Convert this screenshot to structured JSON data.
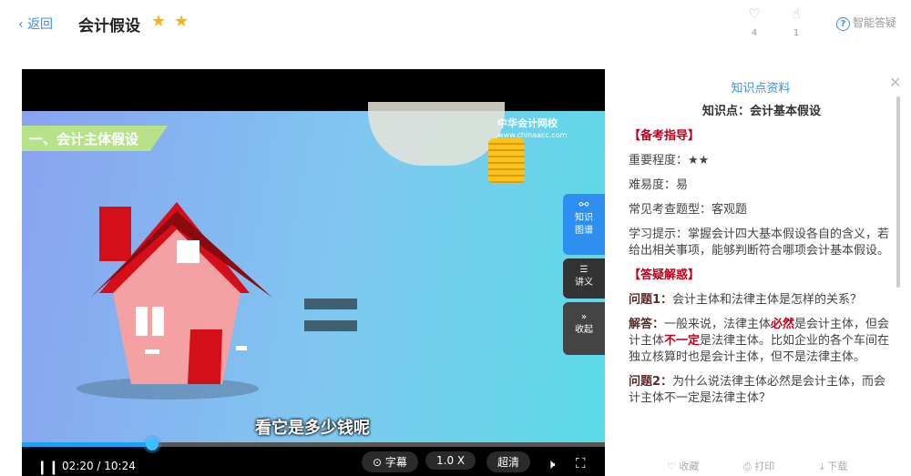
{
  "header": {
    "back": "返回",
    "title": "会计假设",
    "stars": 2,
    "like_count": "4",
    "thumb_count": "1",
    "ai_label": "智能答疑"
  },
  "video": {
    "ribbon": "一、会计主体假设",
    "logo_name": "中华会计网校",
    "logo_url": "www.chinaacc.com",
    "subtitle": "看它是多少钱呢",
    "side": [
      {
        "label1": "知识",
        "label2": "图谱",
        "color": "#2f8ff0"
      },
      {
        "label1": "讲义",
        "color": "#333"
      },
      {
        "label1": "收起",
        "color": "#444"
      }
    ],
    "progress": 0.224,
    "time": "02:20 / 10:24",
    "caption_btn": "字幕",
    "speed": "1.0 X",
    "quality": "超清"
  },
  "panel": {
    "title": "知识点资料",
    "kp": "知识点：会计基本假设",
    "sec1": "【备考指导】",
    "importance": "重要程度：★★",
    "difficulty": "难易度：易",
    "qtype": "常见考查题型：客观题",
    "tip": "学习提示：掌握会计四大基本假设各自的含义，若给出相关事项，能够判断符合哪项会计基本假设。",
    "sec2": "【答疑解惑】",
    "q1_label": "问题1：",
    "q1": "会计主体和法律主体是怎样的关系？",
    "a1_label": "解答：",
    "a1_p1": "一般来说，法律主体",
    "a1_r1": "必然",
    "a1_p2": "是会计主体，但会计主体",
    "a1_r2": "不一定",
    "a1_p3": "是法律主体。比如企业的各个车间在独立核算时也是会计主体，但不是法律主体。",
    "q2_label": "问题2：",
    "q2": "为什么说法律主体必然是会计主体，而会计主体不一定是法律主体？",
    "footer": {
      "collect": "收藏",
      "print": "打印",
      "download": "下载"
    }
  }
}
